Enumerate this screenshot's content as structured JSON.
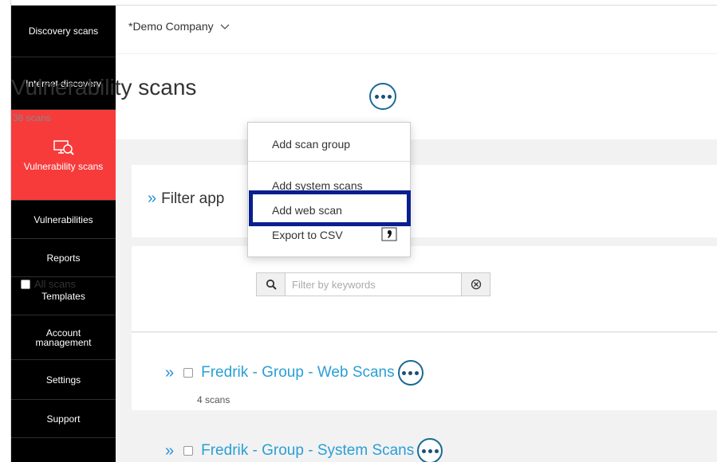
{
  "sidebar": {
    "items": [
      {
        "label": "Discovery scans"
      },
      {
        "label": "Internet discovery"
      },
      {
        "label": "Vulnerability scans"
      },
      {
        "label": "Vulnerabilities"
      },
      {
        "label": "Reports"
      },
      {
        "label": "Templates"
      },
      {
        "label": "Account management"
      },
      {
        "label": "Settings"
      },
      {
        "label": "Support"
      }
    ],
    "active_color": "#f73b3b"
  },
  "header": {
    "company": "*Demo Company",
    "title": "Vulnerability scans",
    "count": "38 scans"
  },
  "menu": {
    "items": [
      "Add scan group",
      "Add system scans",
      "Add web scan",
      "Export to CSV"
    ]
  },
  "filter": {
    "title": "Filter app"
  },
  "list": {
    "all_scans_label": "All scans",
    "search_placeholder": "Filter by keywords",
    "groups": [
      {
        "name": "Fredrik - Group - Web Scans",
        "count": "4 scans"
      },
      {
        "name": "Fredrik - Group - System Scans"
      }
    ]
  },
  "colors": {
    "accent": "#2a9fd6",
    "highlight_border": "#0a1f8f"
  }
}
